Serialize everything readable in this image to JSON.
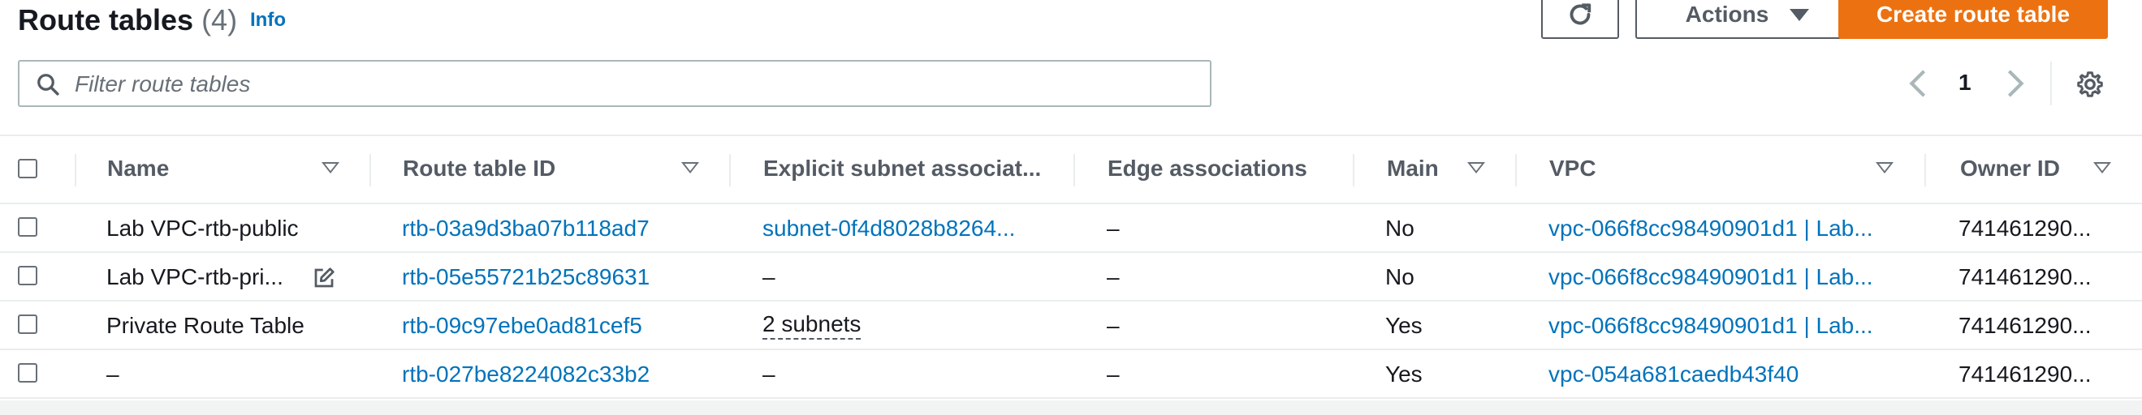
{
  "header": {
    "title": "Route tables",
    "count": "(4)",
    "info_label": "Info",
    "refresh_icon": "refresh-icon",
    "actions_label": "Actions",
    "create_label": "Create route table"
  },
  "filter": {
    "placeholder": "Filter route tables",
    "icon": "search-icon"
  },
  "pagination": {
    "current_page": "1",
    "prev_icon": "chevron-left-icon",
    "next_icon": "chevron-right-icon",
    "settings_icon": "gear-icon"
  },
  "columns": [
    "Name",
    "Route table ID",
    "Explicit subnet associat...",
    "Edge associations",
    "Main",
    "VPC",
    "Owner ID"
  ],
  "rows": [
    {
      "name": "Lab VPC-rtb-public",
      "route_table_id": "rtb-03a9d3ba07b118ad7",
      "explicit_subnet": "subnet-0f4d8028b8264...",
      "edge": "–",
      "main": "No",
      "vpc": "vpc-066f8cc98490901d1 | Lab...",
      "owner": "741461290..."
    },
    {
      "name": "Lab VPC-rtb-pri...",
      "route_table_id": "rtb-05e55721b25c89631",
      "explicit_subnet": "–",
      "edge": "–",
      "main": "No",
      "vpc": "vpc-066f8cc98490901d1 | Lab...",
      "owner": "741461290..."
    },
    {
      "name": "Private Route Table",
      "route_table_id": "rtb-09c97ebe0ad81cef5",
      "explicit_subnet": "2 subnets",
      "edge": "–",
      "main": "Yes",
      "vpc": "vpc-066f8cc98490901d1 | Lab...",
      "owner": "741461290..."
    },
    {
      "name": "–",
      "route_table_id": "rtb-027be8224082c33b2",
      "explicit_subnet": "–",
      "edge": "–",
      "main": "Yes",
      "vpc": "vpc-054a681caedb43f40",
      "owner": "741461290..."
    }
  ],
  "colors": {
    "link": "#0073bb",
    "primary_button": "#ec7211",
    "border": "#eaeded",
    "header_text": "#545b64"
  }
}
